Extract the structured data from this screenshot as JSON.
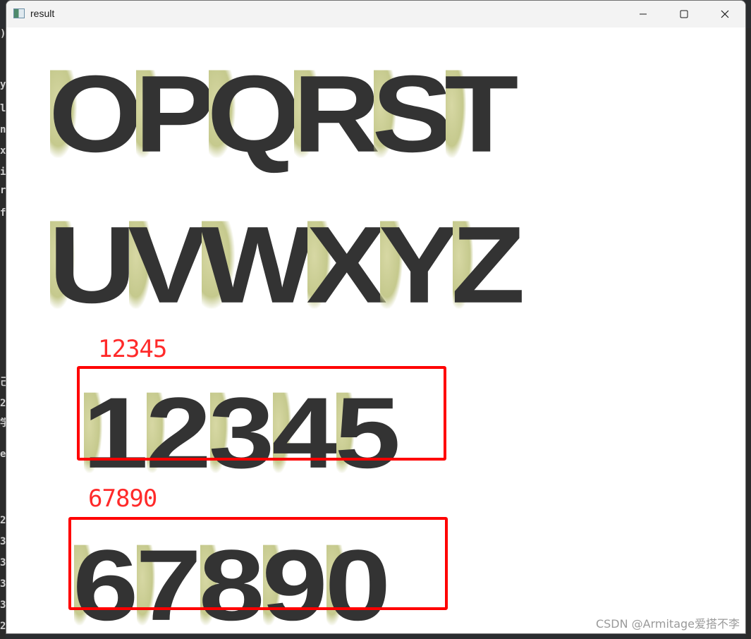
{
  "window": {
    "title": "result",
    "controls": {
      "minimize_icon": "minimize-icon",
      "maximize_icon": "maximize-icon",
      "close_icon": "close-icon"
    }
  },
  "canvas": {
    "letter_rows": [
      [
        "O",
        "P",
        "Q",
        "R",
        "S",
        "T"
      ],
      [
        "U",
        "V",
        "W",
        "X",
        "Y",
        "Z"
      ]
    ],
    "detections": [
      {
        "label": "12345",
        "digits": [
          "1",
          "2",
          "3",
          "4",
          "5"
        ],
        "box_color": "#ff0000"
      },
      {
        "label": "67890",
        "digits": [
          "6",
          "7",
          "8",
          "9",
          "0"
        ],
        "box_color": "#ff0000"
      }
    ],
    "glyph_color": "#333333",
    "glyph_paper_color": "#c5c98d",
    "label_color": "#ff2a2a"
  },
  "watermark": "CSDN @Armitage爱搭不李",
  "left_gutter_glyphs": [
    ")",
    "y",
    "l",
    "n",
    "x",
    "i",
    "r",
    "f",
    "己",
    "2",
    "学",
    "e",
    "2",
    "3",
    "3",
    "3",
    "3",
    "2"
  ]
}
